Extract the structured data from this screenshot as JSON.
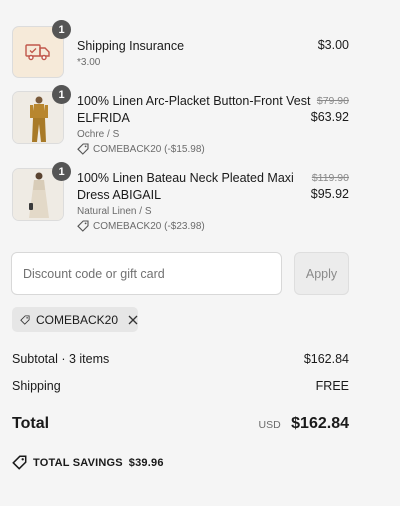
{
  "items": [
    {
      "quantity": "1",
      "title": "Shipping Insurance",
      "subtitle": "*3.00",
      "price": "$3.00",
      "icon": "delivery-truck-icon"
    },
    {
      "quantity": "1",
      "title_line1": "100% Linen Arc-Placket Button-Front Vest",
      "title_line2": "ELFRIDA",
      "variant": "Ochre / S",
      "discount": "COMEBACK20 (-$15.98)",
      "original_price": "$79.90",
      "price": "$63.92",
      "image": "ochre-vest-outfit-photo"
    },
    {
      "quantity": "1",
      "title_line1": "100% Linen Bateau Neck Pleated Maxi",
      "title_line2": "Dress ABIGAIL",
      "variant": "Natural Linen / S",
      "discount": "COMEBACK20 (-$23.98)",
      "original_price": "$119.90",
      "price": "$95.92",
      "image": "natural-linen-dress-photo"
    }
  ],
  "discount_form": {
    "placeholder": "Discount code or gift card",
    "value": "",
    "apply_label": "Apply"
  },
  "applied_code": "COMEBACK20",
  "summary": {
    "subtotal_label": "Subtotal · 3 items",
    "subtotal_value": "$162.84",
    "shipping_label": "Shipping",
    "shipping_value": "FREE",
    "total_label": "Total",
    "currency": "USD",
    "total_value": "$162.84",
    "savings_label": "TOTAL SAVINGS",
    "savings_value": "$39.96"
  },
  "colors": {
    "background": "#f5f5f5",
    "badge": "#555555",
    "muted_text": "#6b6b6b"
  }
}
